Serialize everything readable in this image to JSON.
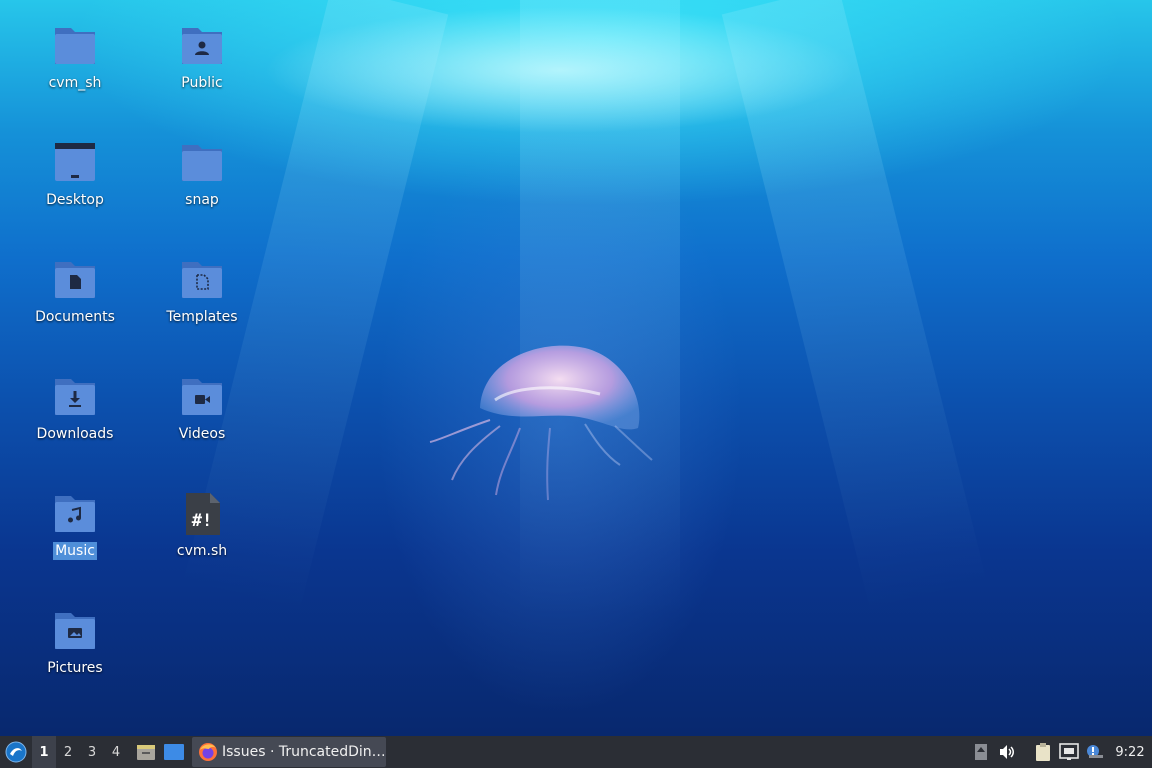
{
  "desktop": {
    "icons": [
      {
        "label": "cvm_sh",
        "type": "folder"
      },
      {
        "label": "Public",
        "type": "folder-public"
      },
      {
        "label": "Desktop",
        "type": "folder-desktop"
      },
      {
        "label": "snap",
        "type": "folder"
      },
      {
        "label": "Documents",
        "type": "folder-documents"
      },
      {
        "label": "Templates",
        "type": "folder-templates"
      },
      {
        "label": "Downloads",
        "type": "folder-downloads"
      },
      {
        "label": "Videos",
        "type": "folder-videos"
      },
      {
        "label": "Music",
        "type": "folder-music",
        "selected": true
      },
      {
        "label": "cvm.sh",
        "type": "shell-script"
      },
      {
        "label": "Pictures",
        "type": "folder-pictures"
      }
    ],
    "wallpaper": "underwater-jellyfish"
  },
  "taskbar": {
    "workspaces": [
      "1",
      "2",
      "3",
      "4"
    ],
    "active_workspace": "1",
    "launchers": [
      "file-manager-icon",
      "show-desktop-icon"
    ],
    "tasks": [
      {
        "label": "Issues · TruncatedDin…",
        "icon": "firefox-icon"
      }
    ],
    "tray": [
      "updates-icon",
      "volume-icon",
      "clipboard-icon",
      "network-icon",
      "notification-icon"
    ],
    "clock": "9:22"
  },
  "colors": {
    "folder": "#5b8ddb",
    "folder_dark": "#3f6fc0",
    "taskbar": "#2b2e35",
    "selection": "#4f8fd9"
  }
}
